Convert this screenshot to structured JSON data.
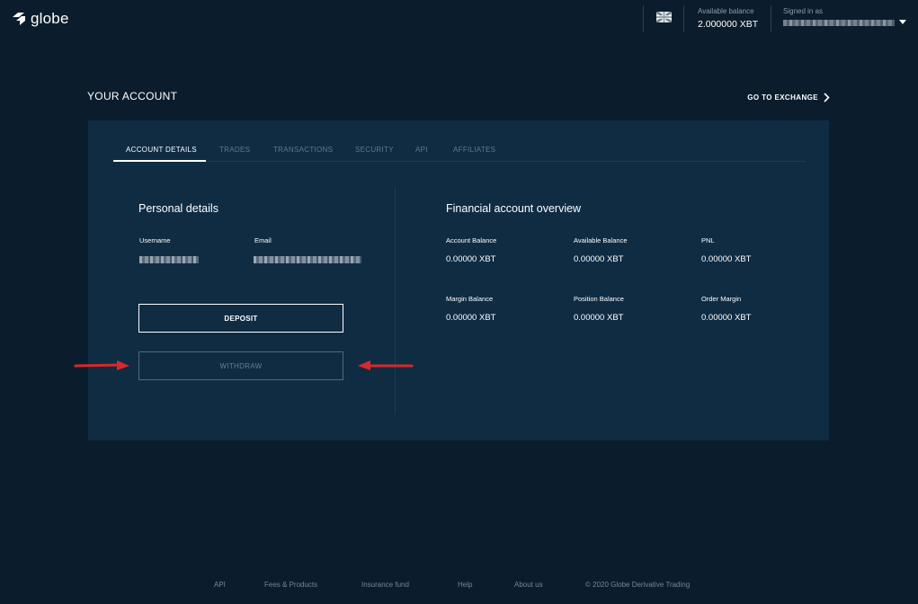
{
  "header": {
    "logo_text": "globe",
    "balance_label": "Available balance",
    "balance_value": "2.000000 XBT",
    "signed_in_label": "Signed in as",
    "flag_icon": "uk-flag-icon"
  },
  "page_title": "YOUR ACCOUNT",
  "goto_exchange_label": "GO TO EXCHANGE",
  "tabs": [
    {
      "label": "ACCOUNT DETAILS",
      "active": true
    },
    {
      "label": "TRADES",
      "active": false
    },
    {
      "label": "TRANSACTIONS",
      "active": false
    },
    {
      "label": "SECURITY",
      "active": false
    },
    {
      "label": "API",
      "active": false
    },
    {
      "label": "AFFILIATES",
      "active": false
    }
  ],
  "personal": {
    "heading": "Personal details",
    "username_label": "Username",
    "email_label": "Email",
    "deposit_label": "DEPOSIT",
    "withdraw_label": "WITHDRAW"
  },
  "financial": {
    "heading": "Financial account overview",
    "account_balance_label": "Account Balance",
    "account_balance_value": "0.00000 XBT",
    "available_balance_label": "Available Balance",
    "available_balance_value": "0.00000 XBT",
    "pnl_label": "PNL",
    "pnl_value": "0.00000 XBT",
    "margin_balance_label": "Margin Balance",
    "margin_balance_value": "0.00000 XBT",
    "position_balance_label": "Position Balance",
    "position_balance_value": "0.00000 XBT",
    "order_margin_label": "Order Margin",
    "order_margin_value": "0.00000 XBT"
  },
  "footer": {
    "api": "API",
    "fees": "Fees & Products",
    "insurance": "Insurance fund",
    "help": "Help",
    "about": "About us",
    "copyright": "© 2020 Globe Derivative Trading"
  },
  "colors": {
    "background": "#0b1d2d",
    "card": "#0f2c43",
    "annotation_arrow": "#d8282a"
  }
}
